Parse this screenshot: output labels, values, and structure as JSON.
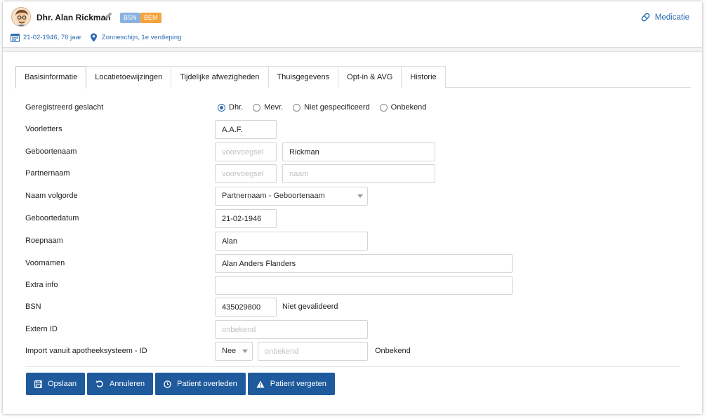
{
  "header": {
    "patient_name": "Dhr. Alan Rickman",
    "badge_bsn": "BSN",
    "badge_bem": "BEM",
    "birth_info": "21-02-1946, 76 jaar",
    "location": "Zonneschijn, 1e verdieping",
    "medicatie_label": "Medicatie"
  },
  "tabs": [
    {
      "label": "Basisinformatie",
      "active": true
    },
    {
      "label": "Locatietoewijzingen",
      "active": false
    },
    {
      "label": "Tijdelijke afwezigheden",
      "active": false
    },
    {
      "label": "Thuisgegevens",
      "active": false
    },
    {
      "label": "Opt-in & AVG",
      "active": false
    },
    {
      "label": "Historie",
      "active": false
    }
  ],
  "form": {
    "geslacht": {
      "label": "Geregistreerd geslacht",
      "options": [
        "Dhr.",
        "Mevr.",
        "Niet gespecificeerd",
        "Onbekend"
      ],
      "selected": "Dhr."
    },
    "voorletters": {
      "label": "Voorletters",
      "value": "A.A.F."
    },
    "geboortenaam": {
      "label": "Geboortenaam",
      "voorvoegsel_placeholder": "voorvoegsel",
      "value": "Rickman"
    },
    "partnernaam": {
      "label": "Partnernaam",
      "voorvoegsel_placeholder": "voorvoegsel",
      "naam_placeholder": "naam"
    },
    "naam_volgorde": {
      "label": "Naam volgorde",
      "value": "Partnernaam - Geboortenaam"
    },
    "geboortedatum": {
      "label": "Geboortedatum",
      "value": "21-02-1946"
    },
    "roepnaam": {
      "label": "Roepnaam",
      "value": "Alan"
    },
    "voornamen": {
      "label": "Voornamen",
      "value": "Alan Anders Flanders"
    },
    "extra_info": {
      "label": "Extra info",
      "value": ""
    },
    "bsn": {
      "label": "BSN",
      "value": "435029800",
      "status": "Niet gevalideerd"
    },
    "extern_id": {
      "label": "Extern ID",
      "placeholder": "onbekend"
    },
    "import_id": {
      "label": "Import vanuit apotheeksysteem - ID",
      "select_value": "Nee",
      "placeholder": "onbekend",
      "status": "Onbekend"
    }
  },
  "buttons": {
    "opslaan": "Opslaan",
    "annuleren": "Annuleren",
    "overleden": "Patient overleden",
    "vergeten": "Patient vergeten"
  },
  "colors": {
    "accent": "#2c6db3",
    "button_bg": "#1e5a9c",
    "badge_bsn": "#8ab2e0",
    "badge_bem": "#f4a33d"
  }
}
